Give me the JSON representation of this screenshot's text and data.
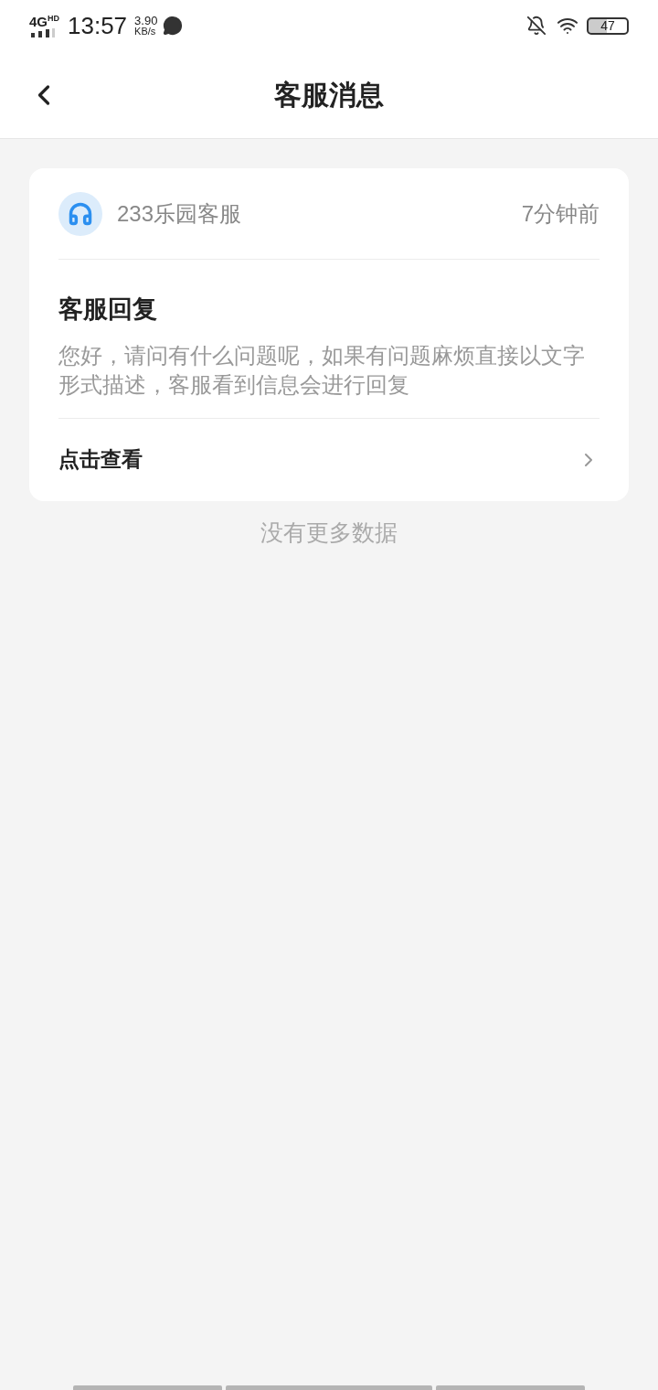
{
  "status_bar": {
    "network": "4G",
    "network_badge": "HD",
    "time": "13:57",
    "speed_value": "3.90",
    "speed_unit": "KB/s",
    "battery": "47"
  },
  "header": {
    "title": "客服消息"
  },
  "messages": [
    {
      "sender": "233乐园客服",
      "time": "7分钟前",
      "title": "客服回复",
      "body": "您好，请问有什么问题呢，如果有问题麻烦直接以文字形式描述，客服看到信息会进行回复",
      "action": "点击查看"
    }
  ],
  "footer_note": "没有更多数据"
}
